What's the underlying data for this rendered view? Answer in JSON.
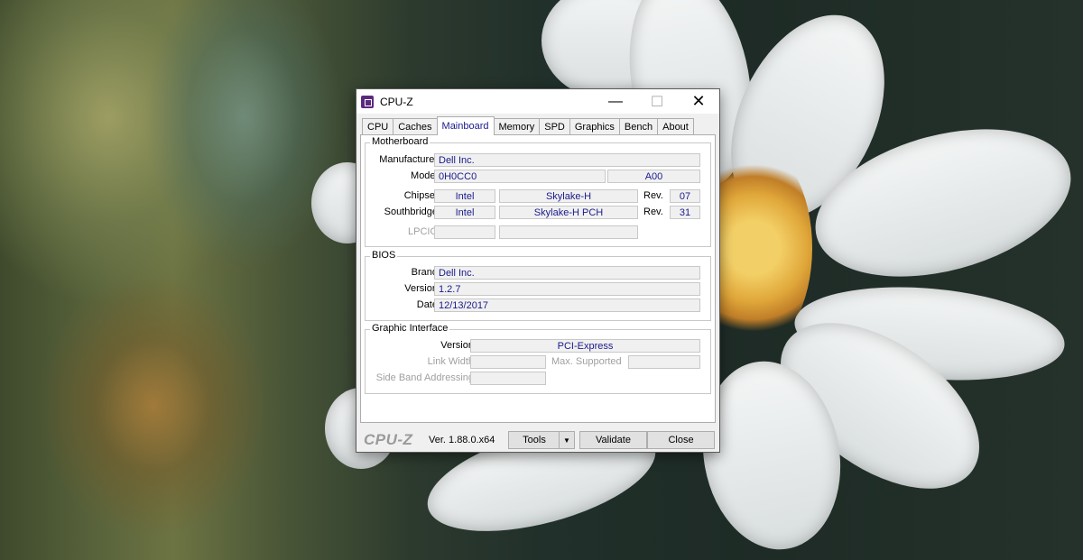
{
  "window": {
    "title": "CPU-Z",
    "min_glyph": "—",
    "max_glyph": "☐",
    "close_glyph": "✕"
  },
  "tabs": [
    {
      "label": "CPU"
    },
    {
      "label": "Caches"
    },
    {
      "label": "Mainboard"
    },
    {
      "label": "Memory"
    },
    {
      "label": "SPD"
    },
    {
      "label": "Graphics"
    },
    {
      "label": "Bench"
    },
    {
      "label": "About"
    }
  ],
  "active_tab": "Mainboard",
  "motherboard": {
    "group_title": "Motherboard",
    "manufacturer_label": "Manufacturer",
    "manufacturer": "Dell Inc.",
    "model_label": "Model",
    "model": "0H0CC0",
    "model_rev": "A00",
    "chipset_label": "Chipset",
    "chipset_vendor": "Intel",
    "chipset_name": "Skylake-H",
    "rev_label": "Rev.",
    "chipset_rev": "07",
    "southbridge_label": "Southbridge",
    "southbridge_vendor": "Intel",
    "southbridge_name": "Skylake-H PCH",
    "southbridge_rev": "31",
    "lpcio_label": "LPCIO"
  },
  "bios": {
    "group_title": "BIOS",
    "brand_label": "Brand",
    "brand": "Dell Inc.",
    "version_label": "Version",
    "version": "1.2.7",
    "date_label": "Date",
    "date": "12/13/2017"
  },
  "graphic_interface": {
    "group_title": "Graphic Interface",
    "version_label": "Version",
    "version": "PCI-Express",
    "link_width_label": "Link Width",
    "max_supported_label": "Max. Supported",
    "side_band_label": "Side Band Addressing"
  },
  "footer": {
    "logo": "CPU-Z",
    "version": "Ver. 1.88.0.x64",
    "tools_label": "Tools",
    "tools_arrow": "▼",
    "validate_label": "Validate",
    "close_label": "Close"
  },
  "colors": {
    "value_text": "#1a1a8c",
    "title_bar": "#ffffff",
    "window_bg": "#f0f0f0"
  }
}
